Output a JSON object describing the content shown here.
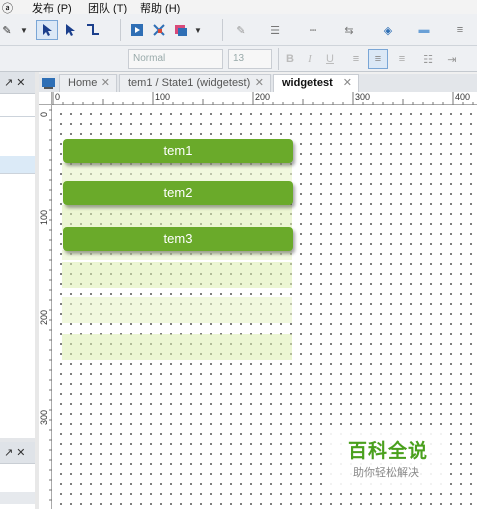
{
  "menu": {
    "items": [
      "ⓐ",
      "发布 (P)",
      "团队 (T)",
      "帮助 (H)"
    ]
  },
  "toolbar": {
    "font_name": "Normal",
    "font_size": "13",
    "bold": "B",
    "italic": "I",
    "underline": "U"
  },
  "left_panel": {
    "top_controls": "↗ ✕",
    "bottom_controls": "↗ ✕"
  },
  "tabs": [
    {
      "label": "Home",
      "close": "✕"
    },
    {
      "label": "tem1 / State1 (widgetest)",
      "close": "✕"
    },
    {
      "label": "widgetest",
      "close": "✕"
    }
  ],
  "ruler": {
    "top_labels": [
      "0",
      "100",
      "200",
      "300",
      "400"
    ],
    "left_labels": [
      "0",
      "100",
      "200",
      "300"
    ]
  },
  "canvas": {
    "items": [
      {
        "label": "tem1"
      },
      {
        "label": "tem2"
      },
      {
        "label": "tem3"
      }
    ]
  },
  "watermark": {
    "title": "百科全说",
    "subtitle": "助你轻松解决"
  },
  "colors": {
    "item_button": "#6aaa2a",
    "row_highlight": "#dceeaf",
    "watermark_green": "#4aa01d"
  }
}
